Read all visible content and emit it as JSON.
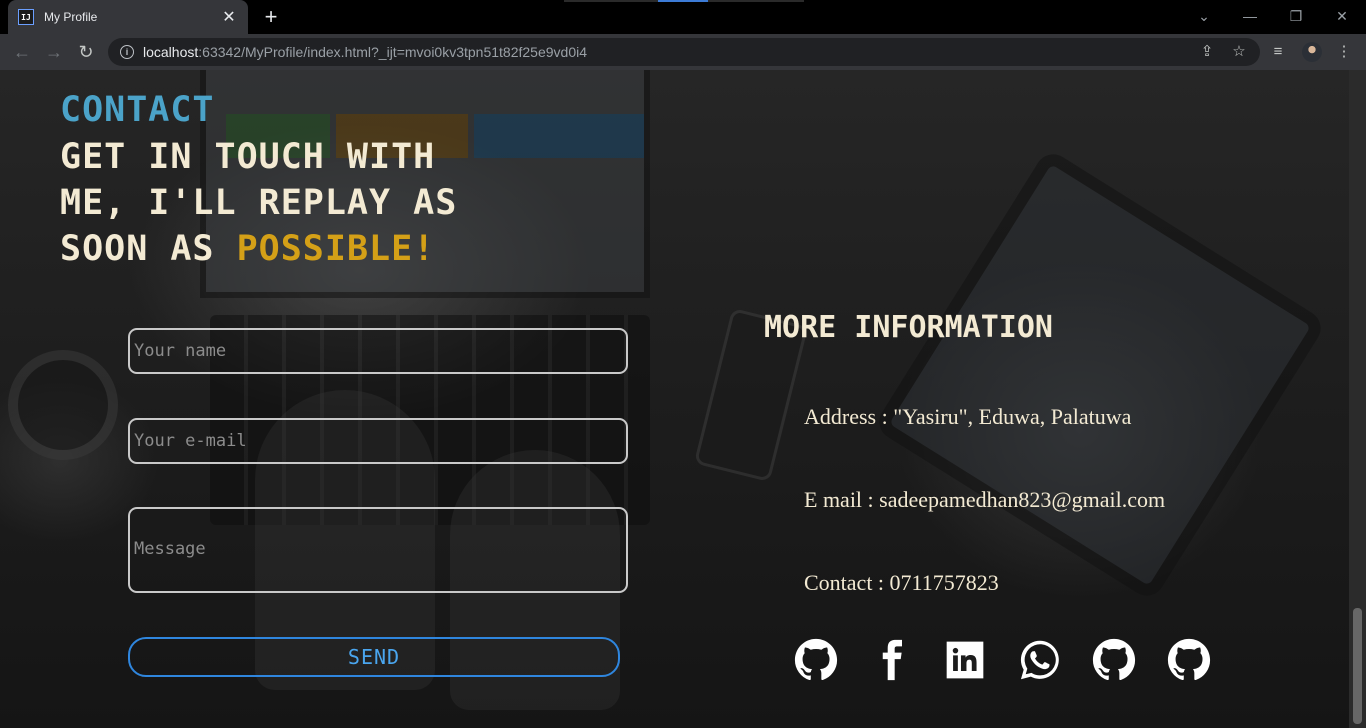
{
  "browser": {
    "tab_title": "My Profile",
    "tab_favicon": "IJ",
    "url_host": "localhost",
    "url_rest": ":63342/MyProfile/index.html?_ijt=mvoi0kv3tpn51t82f25e9vd0i4"
  },
  "icons": [
    "close-icon",
    "plus-icon",
    "back-arrow-icon",
    "forward-arrow-icon",
    "reload-icon",
    "info-icon",
    "share-icon",
    "star-icon",
    "media-list-icon",
    "avatar",
    "kebab-menu-icon"
  ],
  "contact": {
    "label": "CONTACT",
    "headline": "GET IN TOUCH WITH ME, I'LL REPLAY AS SOON AS",
    "headline_accent": "POSSIBLE!"
  },
  "form": {
    "name_placeholder": "Your name",
    "email_placeholder": "Your e-mail",
    "message_placeholder": "Message",
    "send_label": "SEND"
  },
  "more_info": {
    "title": "MORE INFORMATION",
    "address": "Address : \"Yasiru\", Eduwa, Palatuwa",
    "email": "E mail  : sadeepamedhan823@gmail.com",
    "contact": "Contact : 0711757823"
  },
  "social_icons": [
    "github-icon",
    "facebook-icon",
    "linkedin-icon",
    "whatsapp-icon",
    "github-icon",
    "github-icon"
  ],
  "colors": {
    "contact_label": "#4ba3c9",
    "headline": "#f3ead3",
    "accent": "#d4a017",
    "send_border": "#2f86de"
  }
}
